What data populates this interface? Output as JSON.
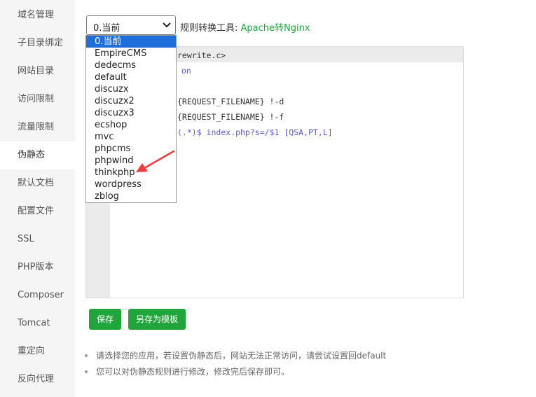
{
  "sidebar": {
    "items": [
      {
        "label": "域名管理"
      },
      {
        "label": "子目录绑定"
      },
      {
        "label": "网站目录"
      },
      {
        "label": "访问限制"
      },
      {
        "label": "流量限制"
      },
      {
        "label": "伪静态",
        "active": true
      },
      {
        "label": "默认文档"
      },
      {
        "label": "配置文件"
      },
      {
        "label": "SSL"
      },
      {
        "label": "PHP版本"
      },
      {
        "label": "Composer"
      },
      {
        "label": "Tomcat"
      },
      {
        "label": "重定向"
      },
      {
        "label": "反向代理"
      }
    ]
  },
  "rewrite_select": {
    "value": "0.当前",
    "options": [
      "0.当前",
      "EmpireCMS",
      "dedecms",
      "default",
      "discuzx",
      "discuzx2",
      "discuzx3",
      "ecshop",
      "mvc",
      "phpcms",
      "phpwind",
      "thinkphp",
      "wordpress",
      "zblog"
    ]
  },
  "converter": {
    "label": "规则转换工具:",
    "link": "Apache转Nginx"
  },
  "editor": {
    "lines": [
      {
        "text": "rewrite.c>"
      },
      {
        "text": "on",
        "keyword": true
      },
      {
        "text": "{REQUEST_FILENAME} !-d"
      },
      {
        "text": "{REQUEST_FILENAME} !-f"
      },
      {
        "prefix": "(.*)$ ",
        "text": "index.php?s=/$1 [QSA,PT,L]"
      }
    ]
  },
  "buttons": {
    "save": "保存",
    "save_template": "另存为模板"
  },
  "tips": [
    "请选择您的应用，若设置伪静态后，网站无法正常访问，请尝试设置回default",
    "您可以对伪静态规则进行修改，修改完后保存即可。"
  ],
  "colors": {
    "accent": "#20a53a",
    "selection": "#1e6fdb",
    "annotation_arrow": "#f23c3c"
  }
}
